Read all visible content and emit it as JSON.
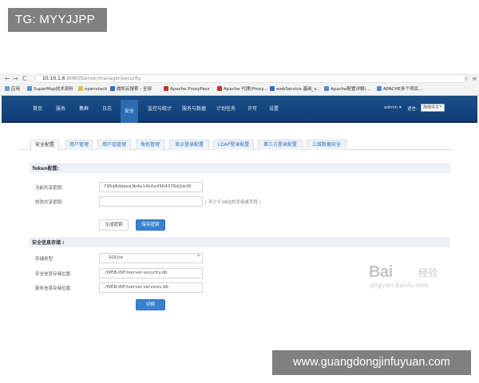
{
  "watermarks": {
    "tg_badge": "TG: MYYJJPP",
    "site_badge": "www.guangdongjinfuyuan.com",
    "baidu_logo_text": "Bai",
    "baidu_logo_cn": "经验",
    "baidu_logo_sub": "jingyan.baidu.com"
  },
  "browser": {
    "url_host": "10.10.1.6",
    "url_path": ":8080/iserver/manager/security",
    "bookmarks": [
      "应用",
      "SuperMap技术资料",
      "openstack",
      "微知云搜索 - 全部",
      "Apache ProxyPass",
      "Apache 代理(Proxy...",
      "webService 基础_v...",
      "Apache配置详解(...",
      "APACHE多个项目..."
    ]
  },
  "navbar": {
    "items": [
      "首页",
      "服务",
      "集群",
      "日志",
      "安全",
      "监控与统计",
      "服务与数据",
      "计划任务",
      "许可",
      "设置"
    ],
    "active_index": 4,
    "user": "admin ▾",
    "lang_label": "语言:",
    "lang_value": "简体中文"
  },
  "tabs": {
    "items": [
      "安全配置",
      "用户管理",
      "用户组管理",
      "角色管理",
      "单点登录配置",
      "LDAP登录配置",
      "第三方登录配置",
      "三维数据安全"
    ],
    "active_index": 0
  },
  "token_section": {
    "title": "Token配置:",
    "current_key_label": "当前共享密钥:",
    "current_key_value": "795a8ddeea3b4e14b0e4564376d2dcf8",
    "modify_key_label": "修改共享密钥:",
    "modify_key_value": "",
    "modify_key_hint": "( 不少于16位的字母或字符 )",
    "generate_button": "生成密钥",
    "save_button": "保存密钥"
  },
  "storage_section": {
    "title": "安全信息存储 :",
    "type_label": "存储类型:",
    "type_value": "SQLite",
    "security_db_label": "安全信息存储位置:",
    "security_db_value": "./WEB-INF/iserver-security.db",
    "services_db_label": "服务信息存储位置:",
    "services_db_value": "./WEB-INF/iserver-services.db",
    "save_button": "切换"
  },
  "colors": {
    "navbar": "#1b4f8a",
    "navbar_active": "#2d6bb3",
    "primary_button": "#3a82d0",
    "tab_link": "#2a6fb6"
  }
}
